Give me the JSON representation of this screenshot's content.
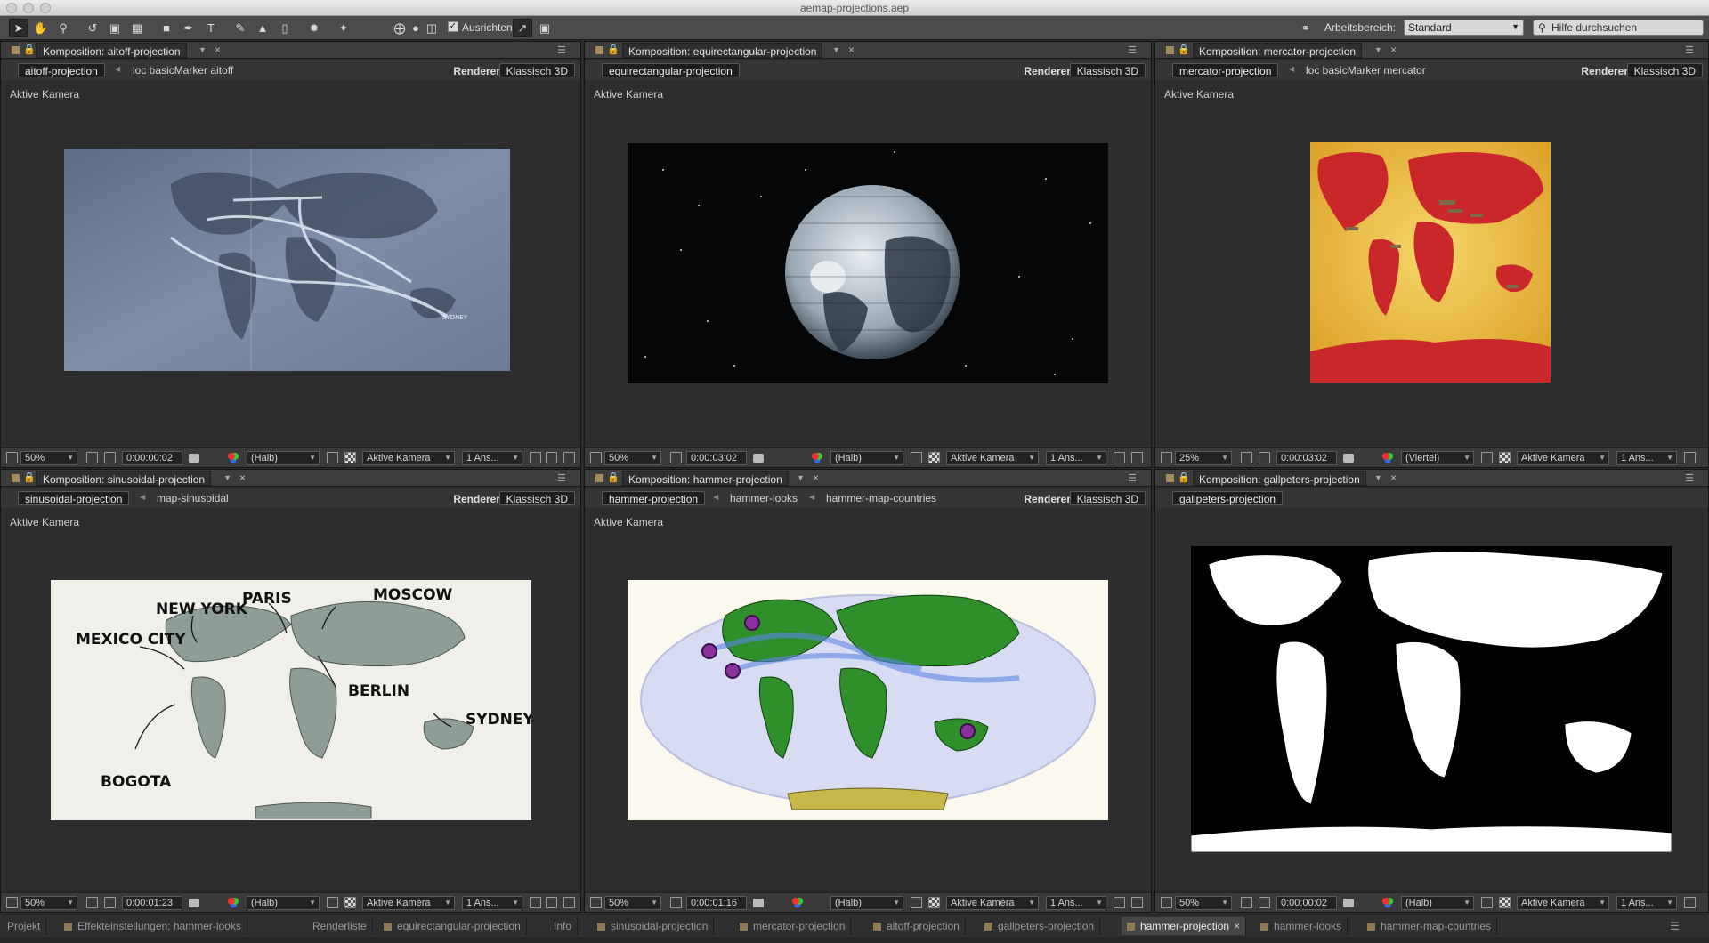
{
  "window": {
    "title": "aemap-projections.aep"
  },
  "toolbar": {
    "align_label": "Ausrichten",
    "workspace_label": "Arbeitsbereich:",
    "workspace_value": "Standard",
    "search_placeholder": "Hilfe durchsuchen",
    "tools": [
      "selection-tool",
      "hand-tool",
      "zoom-tool",
      "rotate-tool",
      "camera-orbit-tool",
      "pan-behind-tool",
      "rectangle-tool",
      "pen-tool",
      "type-tool",
      "brush-tool",
      "clone-stamp-tool",
      "eraser-tool",
      "roto-brush-tool",
      "puppet-pin-tool"
    ]
  },
  "common": {
    "renderer_label": "Renderer:",
    "renderer_value": "Klassisch 3D",
    "active_camera": "Aktive Kamera",
    "view_count": "1 Ans..."
  },
  "panels": [
    {
      "tab": "Komposition: aitoff-projection",
      "crumbs": [
        "aitoff-projection",
        "loc basicMarker aitoff"
      ],
      "renderer": true,
      "zoom": "50%",
      "timecode": "0:00:00:02",
      "resolution": "(Halb)",
      "camera": "Aktive Kamera"
    },
    {
      "tab": "Komposition: equirectangular-projection",
      "crumbs": [
        "equirectangular-projection"
      ],
      "renderer": true,
      "zoom": "50%",
      "timecode": "0:00:03:02",
      "resolution": "(Halb)",
      "camera": "Aktive Kamera"
    },
    {
      "tab": "Komposition: mercator-projection",
      "crumbs": [
        "mercator-projection",
        "loc basicMarker mercator"
      ],
      "renderer": true,
      "zoom": "25%",
      "timecode": "0:00:03:02",
      "resolution": "(Viertel)",
      "camera": "Aktive Kamera"
    },
    {
      "tab": "Komposition: sinusoidal-projection",
      "crumbs": [
        "sinusoidal-projection",
        "map-sinusoidal"
      ],
      "renderer": true,
      "zoom": "50%",
      "timecode": "0:00:01:23",
      "resolution": "(Halb)",
      "camera": "Aktive Kamera"
    },
    {
      "tab": "Komposition: hammer-projection",
      "crumbs": [
        "hammer-projection",
        "hammer-looks",
        "hammer-map-countries"
      ],
      "renderer": true,
      "zoom": "50%",
      "timecode": "0:00:01:16",
      "resolution": "(Halb)",
      "camera": "Aktive Kamera"
    },
    {
      "tab": "Komposition: gallpeters-projection",
      "crumbs": [
        "gallpeters-projection"
      ],
      "renderer": false,
      "zoom": "50%",
      "timecode": "0:00:00:02",
      "resolution": "(Halb)",
      "camera": "Aktive Kamera"
    }
  ],
  "map_labels": {
    "aitoff": [
      "SYDNEY"
    ],
    "sinusoidal": [
      "NEW YORK",
      "PARIS",
      "MOSCOW",
      "MEXICO CITY",
      "BERLIN",
      "SYDNEY",
      "BOGOTA"
    ]
  },
  "bottom_tabs": [
    "Projekt",
    "Effekteinstellungen: hammer-looks",
    "Renderliste",
    "equirectangular-projection",
    "Info",
    "sinusoidal-projection",
    "mercator-projection",
    "aitoff-projection",
    "gallpeters-projection",
    "hammer-projection",
    "hammer-looks",
    "hammer-map-countries"
  ],
  "colors": {
    "panel_bg": "#2d2d2d",
    "label_color": "#a58a5d",
    "mercator_land": "#c9272a",
    "mercator_sea": "#f0c33f",
    "hammer_land": "#2f8f2a"
  }
}
